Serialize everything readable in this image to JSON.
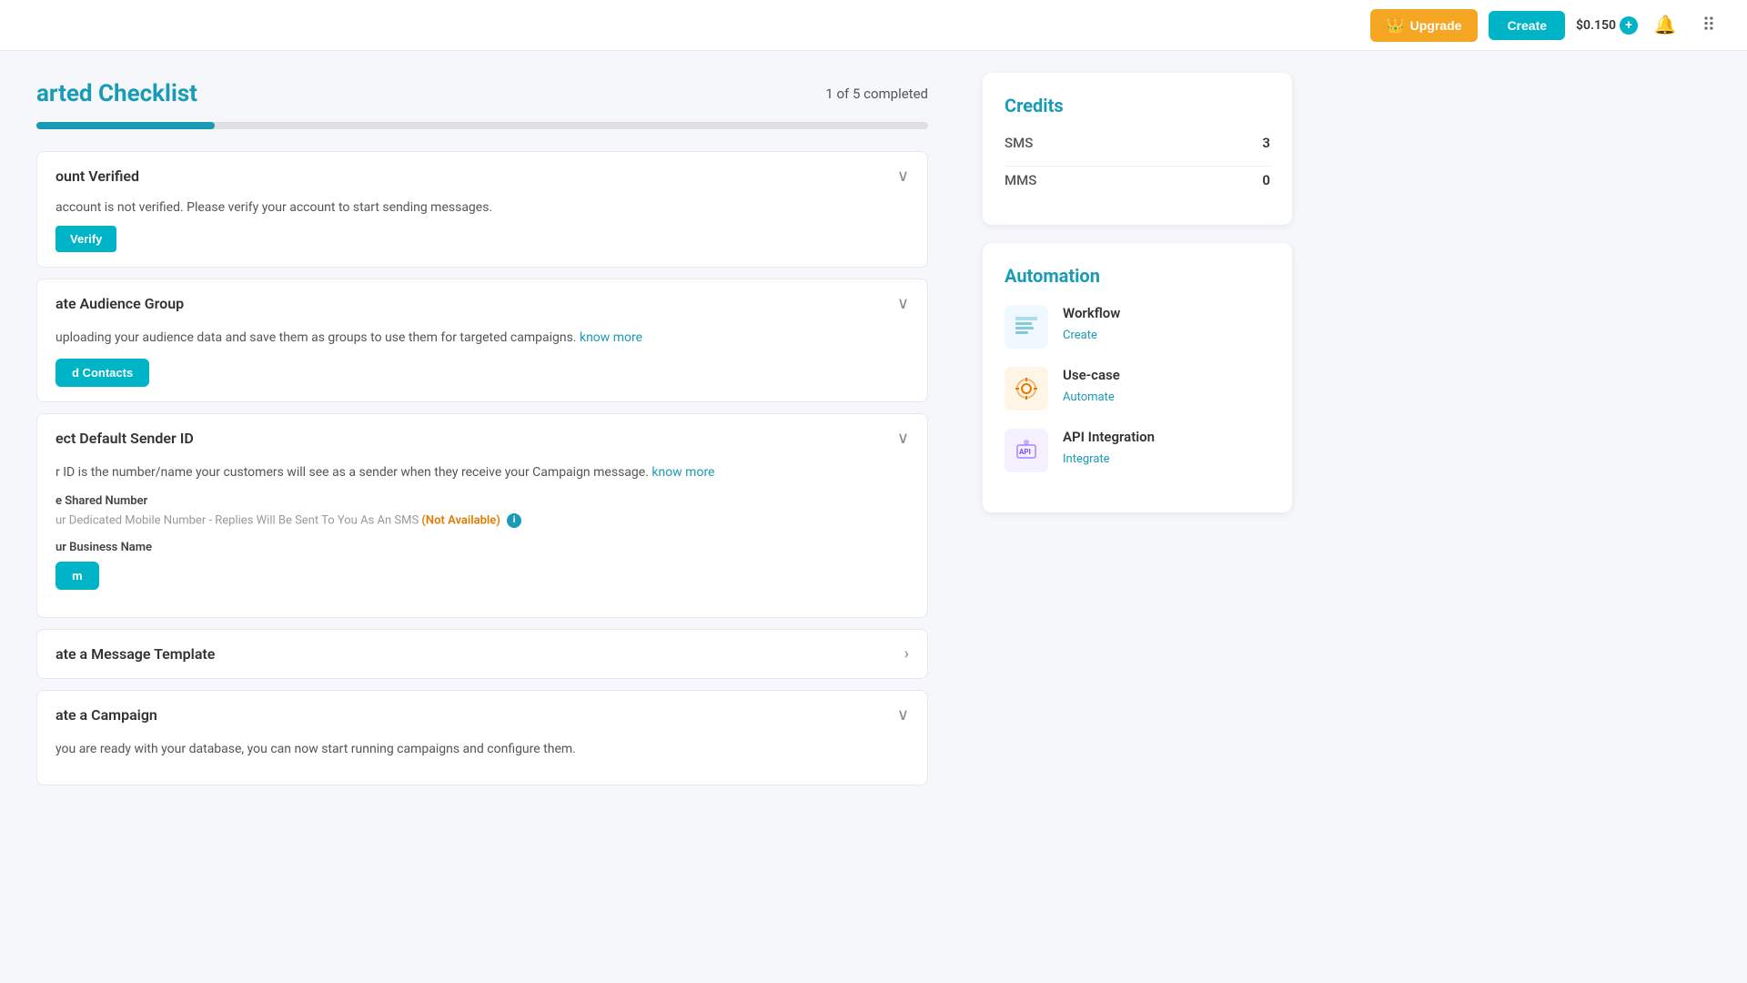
{
  "navbar": {
    "upgrade_label": "Upgrade",
    "create_label": "Create",
    "credit_amount": "$0.150",
    "crown_icon": "👑",
    "bell_icon": "🔔",
    "grid_icon": "⊞"
  },
  "checklist": {
    "title": "arted Checklist",
    "completion_text": "1 of 5 completed",
    "progress_percent": 20,
    "sections": [
      {
        "id": "account-verified",
        "title": "ount Verified",
        "expanded": true,
        "description": "account is not verified. Please verify your account to start sending messages.",
        "action_label": "",
        "chevron": "∨"
      },
      {
        "id": "audience-group",
        "title": "ate Audience Group",
        "expanded": true,
        "description": "uploading your audience data and save them as groups to use them for targeted campaigns.",
        "know_more_text": "know more",
        "know_more_href": "#",
        "action_label": "d Contacts",
        "chevron": "∨"
      },
      {
        "id": "sender-id",
        "title": "ect Default Sender ID",
        "expanded": true,
        "description": "r ID is the number/name your customers will see as a sender when they receive your Campaign message.",
        "know_more_text": "know more",
        "know_more_href": "#",
        "shared_number_label": "e Shared Number",
        "dedicated_number_text": "ur Dedicated Mobile Number - Replies Will Be Sent To You As An SMS",
        "not_available_text": "(Not Available)",
        "business_name_label": "ur Business Name",
        "confirm_label": "m",
        "chevron": "∨"
      },
      {
        "id": "message-template",
        "title": "ate a Message Template",
        "expanded": false,
        "chevron": "›"
      },
      {
        "id": "create-campaign",
        "title": "ate a Campaign",
        "expanded": true,
        "description": "you are ready with your database, you can now start running campaigns and configure them.",
        "chevron": "∨"
      }
    ]
  },
  "credits_card": {
    "title": "Credits",
    "sms_label": "SMS",
    "sms_value": "3",
    "mms_label": "MMS",
    "mms_value": "0"
  },
  "automation_card": {
    "title": "Automation",
    "items": [
      {
        "id": "workflow",
        "name": "Workflow",
        "action_label": "Create",
        "icon_symbol": "📋"
      },
      {
        "id": "usecase",
        "name": "Use-case",
        "action_label": "Automate",
        "icon_symbol": "⚙️"
      },
      {
        "id": "api-integration",
        "name": "API Integration",
        "action_label": "Integrate",
        "icon_symbol": "🔌"
      }
    ]
  }
}
